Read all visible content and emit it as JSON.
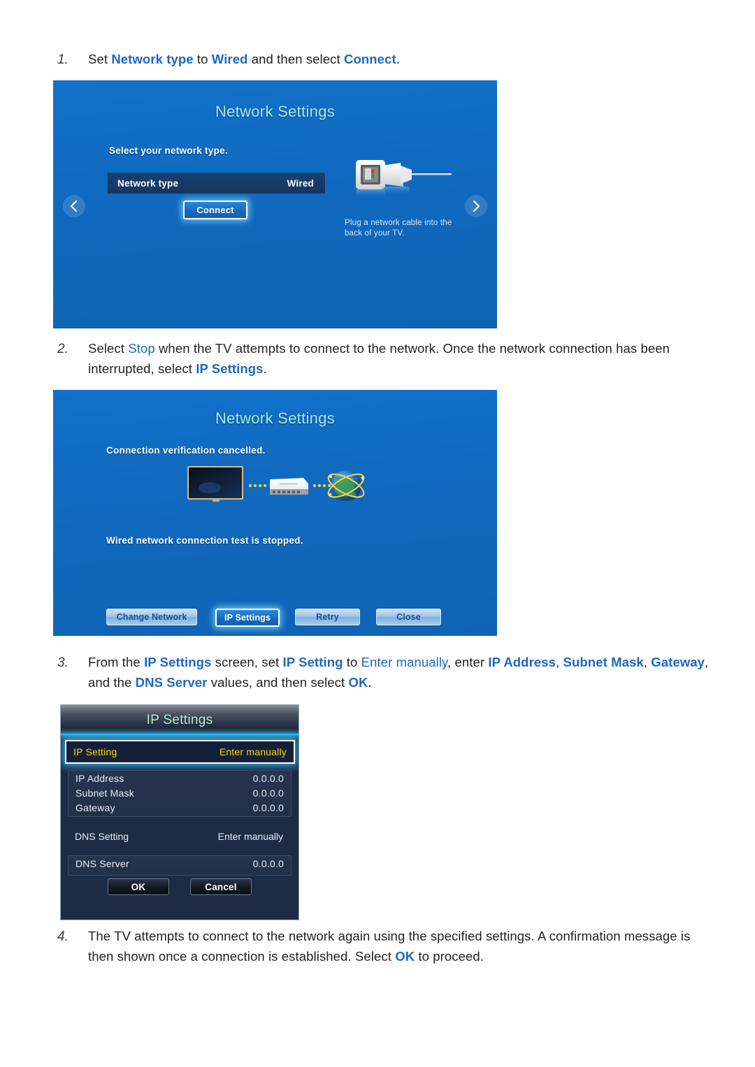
{
  "steps": [
    {
      "num": "1.",
      "parts": [
        {
          "t": "Set ",
          "s": "plain"
        },
        {
          "t": "Network type",
          "s": "kw"
        },
        {
          "t": " to ",
          "s": "plain"
        },
        {
          "t": "Wired",
          "s": "kw"
        },
        {
          "t": " and then select ",
          "s": "plain"
        },
        {
          "t": "Connect",
          "s": "kw"
        },
        {
          "t": ".",
          "s": "plain"
        }
      ]
    },
    {
      "num": "2.",
      "parts": [
        {
          "t": "Select ",
          "s": "plain"
        },
        {
          "t": "Stop",
          "s": "kwn"
        },
        {
          "t": " when the TV attempts to connect to the network. Once the network connection has been interrupted, select ",
          "s": "plain"
        },
        {
          "t": "IP Settings",
          "s": "kw"
        },
        {
          "t": ".",
          "s": "plain"
        }
      ]
    },
    {
      "num": "3.",
      "parts": [
        {
          "t": "From the ",
          "s": "plain"
        },
        {
          "t": "IP Settings",
          "s": "kw"
        },
        {
          "t": " screen, set ",
          "s": "plain"
        },
        {
          "t": "IP Setting",
          "s": "kw"
        },
        {
          "t": " to ",
          "s": "plain"
        },
        {
          "t": "Enter manually",
          "s": "kwn"
        },
        {
          "t": ", enter ",
          "s": "plain"
        },
        {
          "t": "IP Address",
          "s": "kw"
        },
        {
          "t": ", ",
          "s": "plain"
        },
        {
          "t": "Subnet Mask",
          "s": "kw"
        },
        {
          "t": ", ",
          "s": "plain"
        },
        {
          "t": "Gateway",
          "s": "kw"
        },
        {
          "t": ", and the ",
          "s": "plain"
        },
        {
          "t": "DNS Server",
          "s": "kw"
        },
        {
          "t": " values, and then select ",
          "s": "plain"
        },
        {
          "t": "OK",
          "s": "kw"
        },
        {
          "t": ".",
          "s": "plain"
        }
      ]
    },
    {
      "num": "4.",
      "parts": [
        {
          "t": "The TV attempts to connect to the network again using the specified settings. A confirmation message is then shown once a connection is established. Select ",
          "s": "plain"
        },
        {
          "t": "OK",
          "s": "kw"
        },
        {
          "t": " to proceed.",
          "s": "plain"
        }
      ]
    }
  ],
  "screen1": {
    "title": "Network Settings",
    "subtitle": "Select your network type.",
    "network_type_label": "Network type",
    "network_type_value": "Wired",
    "connect_button": "Connect",
    "cable_hint": "Plug a network cable into the back of your TV.",
    "prev_arrow_icon": "chevron-left-icon",
    "next_arrow_icon": "chevron-right-icon"
  },
  "screen2": {
    "title": "Network Settings",
    "status_top": "Connection verification cancelled.",
    "status_bottom": "Wired network connection test is stopped.",
    "buttons": [
      {
        "label": "Change Network",
        "selected": false
      },
      {
        "label": "IP Settings",
        "selected": true
      },
      {
        "label": "Retry",
        "selected": false
      },
      {
        "label": "Close",
        "selected": false
      }
    ]
  },
  "ip_dialog": {
    "title": "IP Settings",
    "selected_row": {
      "label": "IP Setting",
      "value": "Enter manually"
    },
    "address_rows": [
      {
        "label": "IP Address",
        "value": "0.0.0.0"
      },
      {
        "label": "Subnet Mask",
        "value": "0.0.0.0"
      },
      {
        "label": "Gateway",
        "value": "0.0.0.0"
      }
    ],
    "dns_setting": {
      "label": "DNS Setting",
      "value": "Enter manually"
    },
    "dns_server": {
      "label": "DNS Server",
      "value": "0.0.0.0"
    },
    "ok_button": "OK",
    "cancel_button": "Cancel"
  },
  "colors": {
    "link_blue": "#1b69c4",
    "tv_blue": "#1069be",
    "tv_title_green": "#a6e9ec",
    "highlight_yellow": "#ffd400",
    "glow_cyan": "#3cc8ff"
  }
}
